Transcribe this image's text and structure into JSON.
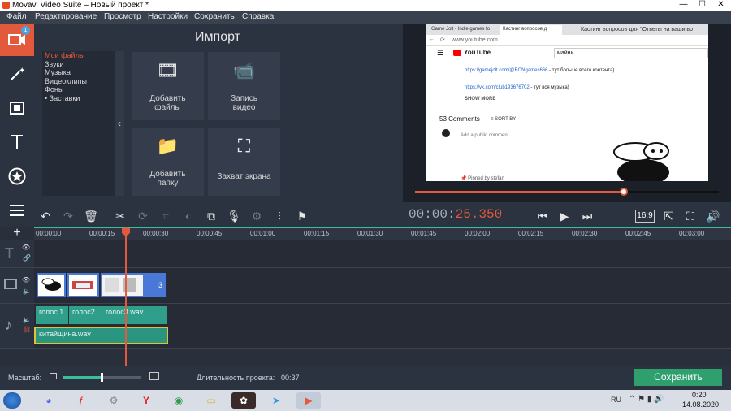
{
  "window": {
    "title": "Movavi Video Suite – Новый проект *",
    "minimize": "—",
    "maximize": "☐",
    "close": "✕"
  },
  "menu": [
    "Файл",
    "Редактирование",
    "Просмотр",
    "Настройки",
    "Сохранить",
    "Справка"
  ],
  "leftbar": {
    "import_badge": "1",
    "icons": [
      "import-icon",
      "magic-wand-icon",
      "filmstrip-icon",
      "text-icon",
      "star-icon",
      "menu-icon"
    ]
  },
  "import": {
    "title": "Импорт",
    "categories": [
      "Мои файлы",
      "Звуки",
      "Музыка",
      "Видеоклипы",
      "Фоны",
      "Заставки"
    ],
    "collapse_glyph": "‹",
    "tiles": [
      {
        "label_line1": "Добавить",
        "label_line2": "файлы",
        "icon": "add-files-icon"
      },
      {
        "label_line1": "Запись",
        "label_line2": "видео",
        "icon": "camera-icon"
      },
      {
        "label_line1": "Добавить",
        "label_line2": "папку",
        "icon": "folder-icon"
      },
      {
        "label_line1": "Захват экрана",
        "label_line2": "",
        "icon": "screen-capture-icon"
      }
    ]
  },
  "preview": {
    "tab1": "Game Jolt - Indie games fo",
    "tab2": "Кастинг вопросов д",
    "tab_new": "+",
    "tab_right": "Кастинг вопросов для \"Ответы на ваши во",
    "url": "www.youtube.com",
    "yt_logo": "YouTube",
    "yt_search": "майни",
    "link1": "https://gamejolt.com/@BONgames666",
    "link1_tail": " - тут больше всего контента)",
    "link2": "https://vk.com/club193676702",
    "link2_tail": " - тут вся музыка)",
    "show_more": "SHOW MORE",
    "comments": "53 Comments",
    "sort": "SORT BY",
    "add_comment": "Add a public comment...",
    "pinned": "Pinned by stefan",
    "progress_fraction": 0.686
  },
  "toolbar": {
    "timecode_grey": "00:00:",
    "timecode_red": "25.350",
    "aspect": "16:9"
  },
  "timeline": {
    "ruler": [
      "00:00:00",
      "00:00:15",
      "00:00:30",
      "00:00:45",
      "00:01:00",
      "00:01:15",
      "00:01:30",
      "00:01:45",
      "00:02:00",
      "00:02:15",
      "00:02:30",
      "00:02:45",
      "00:03:00"
    ],
    "video_clip_label": "3",
    "audio_clips": [
      "голос 1",
      "голос2",
      "голос3.wav"
    ],
    "music_clip": "китайщина.wav"
  },
  "bottom": {
    "scale_label": "Масштаб:",
    "duration_label": "Длительность проекта:",
    "duration_value": "00:37",
    "save_label": "Сохранить",
    "zoom_fraction": 0.48
  },
  "taskbar": {
    "lang": "RU",
    "time": "0:20",
    "date": "14.08.2020"
  }
}
